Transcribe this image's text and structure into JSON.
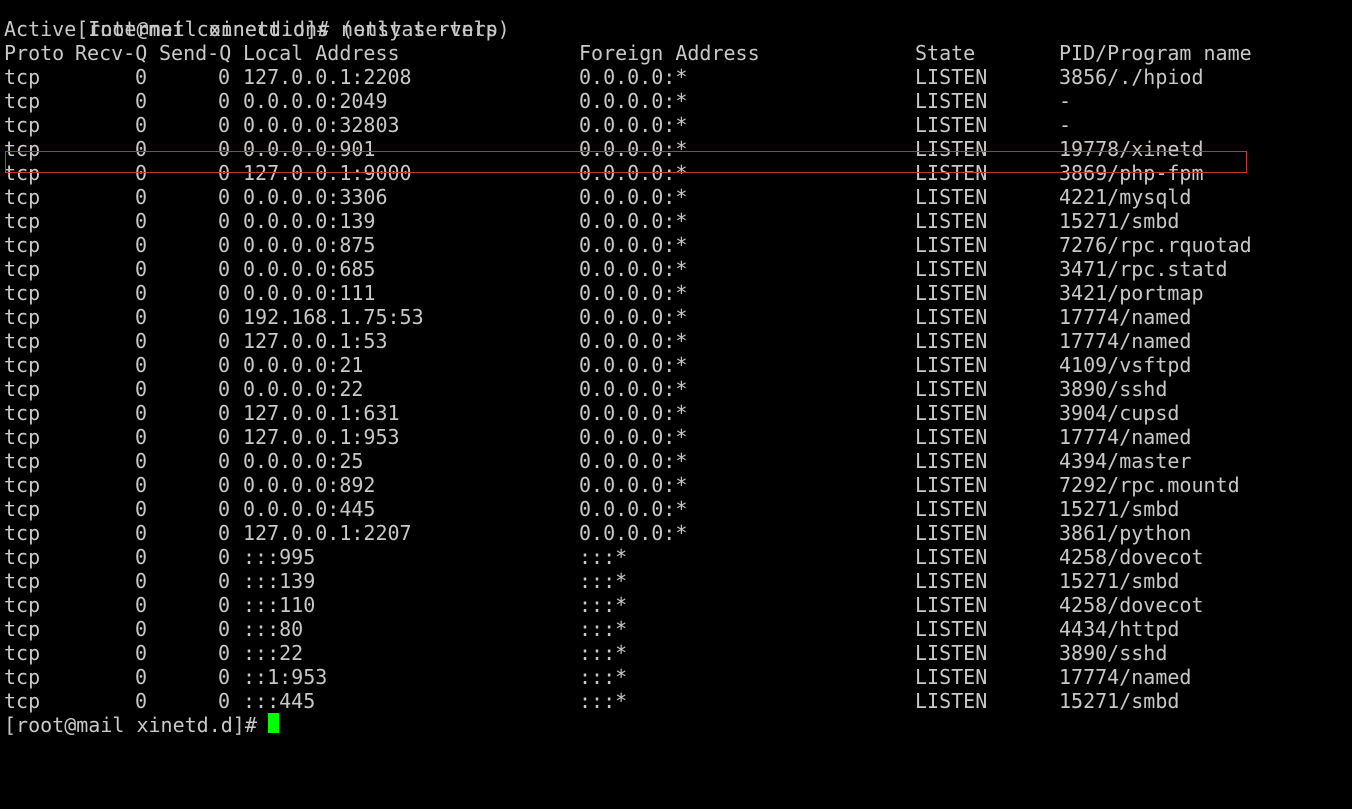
{
  "terminal": {
    "prev_prompt_fragment": "[ro  ]        /xinetd",
    "command_prompt": "[root@mail xinetd.d]# ",
    "command": "netstat -tnlp",
    "heading": "Active Internet connections (only servers)",
    "columns": {
      "proto": "Proto",
      "recv_q": "Recv-Q",
      "send_q": "Send-Q",
      "local": "Local Address",
      "foreign": "Foreign Address",
      "state": "State",
      "pid": "PID/Program name"
    },
    "rows": [
      {
        "proto": "tcp",
        "recv": "0",
        "send": "0",
        "local": "127.0.0.1:2208",
        "foreign": "0.0.0.0:*",
        "state": "LISTEN",
        "pid": "3856/./hpiod"
      },
      {
        "proto": "tcp",
        "recv": "0",
        "send": "0",
        "local": "0.0.0.0:2049",
        "foreign": "0.0.0.0:*",
        "state": "LISTEN",
        "pid": "-"
      },
      {
        "proto": "tcp",
        "recv": "0",
        "send": "0",
        "local": "0.0.0.0:32803",
        "foreign": "0.0.0.0:*",
        "state": "LISTEN",
        "pid": "-"
      },
      {
        "proto": "tcp",
        "recv": "0",
        "send": "0",
        "local": "0.0.0.0:901",
        "foreign": "0.0.0.0:*",
        "state": "LISTEN",
        "pid": "19778/xinetd",
        "highlighted": true
      },
      {
        "proto": "tcp",
        "recv": "0",
        "send": "0",
        "local": "127.0.0.1:9000",
        "foreign": "0.0.0.0:*",
        "state": "LISTEN",
        "pid": "3869/php-fpm"
      },
      {
        "proto": "tcp",
        "recv": "0",
        "send": "0",
        "local": "0.0.0.0:3306",
        "foreign": "0.0.0.0:*",
        "state": "LISTEN",
        "pid": "4221/mysqld"
      },
      {
        "proto": "tcp",
        "recv": "0",
        "send": "0",
        "local": "0.0.0.0:139",
        "foreign": "0.0.0.0:*",
        "state": "LISTEN",
        "pid": "15271/smbd"
      },
      {
        "proto": "tcp",
        "recv": "0",
        "send": "0",
        "local": "0.0.0.0:875",
        "foreign": "0.0.0.0:*",
        "state": "LISTEN",
        "pid": "7276/rpc.rquotad"
      },
      {
        "proto": "tcp",
        "recv": "0",
        "send": "0",
        "local": "0.0.0.0:685",
        "foreign": "0.0.0.0:*",
        "state": "LISTEN",
        "pid": "3471/rpc.statd"
      },
      {
        "proto": "tcp",
        "recv": "0",
        "send": "0",
        "local": "0.0.0.0:111",
        "foreign": "0.0.0.0:*",
        "state": "LISTEN",
        "pid": "3421/portmap"
      },
      {
        "proto": "tcp",
        "recv": "0",
        "send": "0",
        "local": "192.168.1.75:53",
        "foreign": "0.0.0.0:*",
        "state": "LISTEN",
        "pid": "17774/named"
      },
      {
        "proto": "tcp",
        "recv": "0",
        "send": "0",
        "local": "127.0.0.1:53",
        "foreign": "0.0.0.0:*",
        "state": "LISTEN",
        "pid": "17774/named"
      },
      {
        "proto": "tcp",
        "recv": "0",
        "send": "0",
        "local": "0.0.0.0:21",
        "foreign": "0.0.0.0:*",
        "state": "LISTEN",
        "pid": "4109/vsftpd"
      },
      {
        "proto": "tcp",
        "recv": "0",
        "send": "0",
        "local": "0.0.0.0:22",
        "foreign": "0.0.0.0:*",
        "state": "LISTEN",
        "pid": "3890/sshd"
      },
      {
        "proto": "tcp",
        "recv": "0",
        "send": "0",
        "local": "127.0.0.1:631",
        "foreign": "0.0.0.0:*",
        "state": "LISTEN",
        "pid": "3904/cupsd"
      },
      {
        "proto": "tcp",
        "recv": "0",
        "send": "0",
        "local": "127.0.0.1:953",
        "foreign": "0.0.0.0:*",
        "state": "LISTEN",
        "pid": "17774/named"
      },
      {
        "proto": "tcp",
        "recv": "0",
        "send": "0",
        "local": "0.0.0.0:25",
        "foreign": "0.0.0.0:*",
        "state": "LISTEN",
        "pid": "4394/master"
      },
      {
        "proto": "tcp",
        "recv": "0",
        "send": "0",
        "local": "0.0.0.0:892",
        "foreign": "0.0.0.0:*",
        "state": "LISTEN",
        "pid": "7292/rpc.mountd"
      },
      {
        "proto": "tcp",
        "recv": "0",
        "send": "0",
        "local": "0.0.0.0:445",
        "foreign": "0.0.0.0:*",
        "state": "LISTEN",
        "pid": "15271/smbd"
      },
      {
        "proto": "tcp",
        "recv": "0",
        "send": "0",
        "local": "127.0.0.1:2207",
        "foreign": "0.0.0.0:*",
        "state": "LISTEN",
        "pid": "3861/python"
      },
      {
        "proto": "tcp",
        "recv": "0",
        "send": "0",
        "local": ":::995",
        "foreign": ":::*",
        "state": "LISTEN",
        "pid": "4258/dovecot"
      },
      {
        "proto": "tcp",
        "recv": "0",
        "send": "0",
        "local": ":::139",
        "foreign": ":::*",
        "state": "LISTEN",
        "pid": "15271/smbd"
      },
      {
        "proto": "tcp",
        "recv": "0",
        "send": "0",
        "local": ":::110",
        "foreign": ":::*",
        "state": "LISTEN",
        "pid": "4258/dovecot"
      },
      {
        "proto": "tcp",
        "recv": "0",
        "send": "0",
        "local": ":::80",
        "foreign": ":::*",
        "state": "LISTEN",
        "pid": "4434/httpd"
      },
      {
        "proto": "tcp",
        "recv": "0",
        "send": "0",
        "local": ":::22",
        "foreign": ":::*",
        "state": "LISTEN",
        "pid": "3890/sshd"
      },
      {
        "proto": "tcp",
        "recv": "0",
        "send": "0",
        "local": "::1:953",
        "foreign": ":::*",
        "state": "LISTEN",
        "pid": "17774/named"
      },
      {
        "proto": "tcp",
        "recv": "0",
        "send": "0",
        "local": ":::445",
        "foreign": ":::*",
        "state": "LISTEN",
        "pid": "15271/smbd"
      }
    ],
    "final_prompt": "[root@mail xinetd.d]# ",
    "colors": {
      "background": "#000000",
      "text": "#c8c8c8",
      "highlight_border": "#c83232",
      "cursor": "#00ff00"
    }
  }
}
